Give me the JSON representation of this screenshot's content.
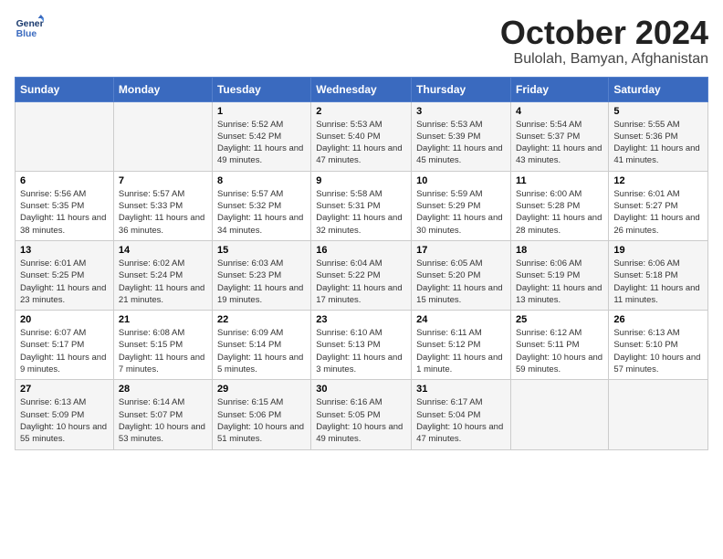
{
  "header": {
    "logo_general": "General",
    "logo_blue": "Blue",
    "title": "October 2024",
    "subtitle": "Bulolah, Bamyan, Afghanistan"
  },
  "weekdays": [
    "Sunday",
    "Monday",
    "Tuesday",
    "Wednesday",
    "Thursday",
    "Friday",
    "Saturday"
  ],
  "weeks": [
    [
      {
        "day": "",
        "info": ""
      },
      {
        "day": "",
        "info": ""
      },
      {
        "day": "1",
        "info": "Sunrise: 5:52 AM\nSunset: 5:42 PM\nDaylight: 11 hours and 49 minutes."
      },
      {
        "day": "2",
        "info": "Sunrise: 5:53 AM\nSunset: 5:40 PM\nDaylight: 11 hours and 47 minutes."
      },
      {
        "day": "3",
        "info": "Sunrise: 5:53 AM\nSunset: 5:39 PM\nDaylight: 11 hours and 45 minutes."
      },
      {
        "day": "4",
        "info": "Sunrise: 5:54 AM\nSunset: 5:37 PM\nDaylight: 11 hours and 43 minutes."
      },
      {
        "day": "5",
        "info": "Sunrise: 5:55 AM\nSunset: 5:36 PM\nDaylight: 11 hours and 41 minutes."
      }
    ],
    [
      {
        "day": "6",
        "info": "Sunrise: 5:56 AM\nSunset: 5:35 PM\nDaylight: 11 hours and 38 minutes."
      },
      {
        "day": "7",
        "info": "Sunrise: 5:57 AM\nSunset: 5:33 PM\nDaylight: 11 hours and 36 minutes."
      },
      {
        "day": "8",
        "info": "Sunrise: 5:57 AM\nSunset: 5:32 PM\nDaylight: 11 hours and 34 minutes."
      },
      {
        "day": "9",
        "info": "Sunrise: 5:58 AM\nSunset: 5:31 PM\nDaylight: 11 hours and 32 minutes."
      },
      {
        "day": "10",
        "info": "Sunrise: 5:59 AM\nSunset: 5:29 PM\nDaylight: 11 hours and 30 minutes."
      },
      {
        "day": "11",
        "info": "Sunrise: 6:00 AM\nSunset: 5:28 PM\nDaylight: 11 hours and 28 minutes."
      },
      {
        "day": "12",
        "info": "Sunrise: 6:01 AM\nSunset: 5:27 PM\nDaylight: 11 hours and 26 minutes."
      }
    ],
    [
      {
        "day": "13",
        "info": "Sunrise: 6:01 AM\nSunset: 5:25 PM\nDaylight: 11 hours and 23 minutes."
      },
      {
        "day": "14",
        "info": "Sunrise: 6:02 AM\nSunset: 5:24 PM\nDaylight: 11 hours and 21 minutes."
      },
      {
        "day": "15",
        "info": "Sunrise: 6:03 AM\nSunset: 5:23 PM\nDaylight: 11 hours and 19 minutes."
      },
      {
        "day": "16",
        "info": "Sunrise: 6:04 AM\nSunset: 5:22 PM\nDaylight: 11 hours and 17 minutes."
      },
      {
        "day": "17",
        "info": "Sunrise: 6:05 AM\nSunset: 5:20 PM\nDaylight: 11 hours and 15 minutes."
      },
      {
        "day": "18",
        "info": "Sunrise: 6:06 AM\nSunset: 5:19 PM\nDaylight: 11 hours and 13 minutes."
      },
      {
        "day": "19",
        "info": "Sunrise: 6:06 AM\nSunset: 5:18 PM\nDaylight: 11 hours and 11 minutes."
      }
    ],
    [
      {
        "day": "20",
        "info": "Sunrise: 6:07 AM\nSunset: 5:17 PM\nDaylight: 11 hours and 9 minutes."
      },
      {
        "day": "21",
        "info": "Sunrise: 6:08 AM\nSunset: 5:15 PM\nDaylight: 11 hours and 7 minutes."
      },
      {
        "day": "22",
        "info": "Sunrise: 6:09 AM\nSunset: 5:14 PM\nDaylight: 11 hours and 5 minutes."
      },
      {
        "day": "23",
        "info": "Sunrise: 6:10 AM\nSunset: 5:13 PM\nDaylight: 11 hours and 3 minutes."
      },
      {
        "day": "24",
        "info": "Sunrise: 6:11 AM\nSunset: 5:12 PM\nDaylight: 11 hours and 1 minute."
      },
      {
        "day": "25",
        "info": "Sunrise: 6:12 AM\nSunset: 5:11 PM\nDaylight: 10 hours and 59 minutes."
      },
      {
        "day": "26",
        "info": "Sunrise: 6:13 AM\nSunset: 5:10 PM\nDaylight: 10 hours and 57 minutes."
      }
    ],
    [
      {
        "day": "27",
        "info": "Sunrise: 6:13 AM\nSunset: 5:09 PM\nDaylight: 10 hours and 55 minutes."
      },
      {
        "day": "28",
        "info": "Sunrise: 6:14 AM\nSunset: 5:07 PM\nDaylight: 10 hours and 53 minutes."
      },
      {
        "day": "29",
        "info": "Sunrise: 6:15 AM\nSunset: 5:06 PM\nDaylight: 10 hours and 51 minutes."
      },
      {
        "day": "30",
        "info": "Sunrise: 6:16 AM\nSunset: 5:05 PM\nDaylight: 10 hours and 49 minutes."
      },
      {
        "day": "31",
        "info": "Sunrise: 6:17 AM\nSunset: 5:04 PM\nDaylight: 10 hours and 47 minutes."
      },
      {
        "day": "",
        "info": ""
      },
      {
        "day": "",
        "info": ""
      }
    ]
  ]
}
